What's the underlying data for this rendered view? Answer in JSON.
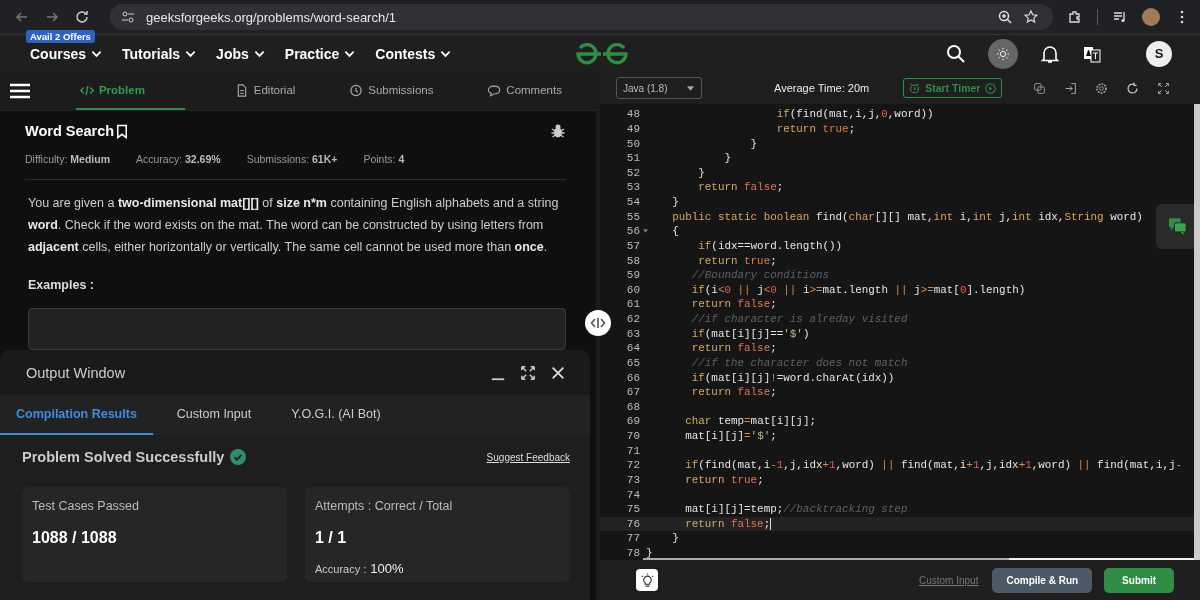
{
  "browser": {
    "url": "geeksforgeeks.org/problems/word-search/1"
  },
  "site_nav": {
    "offer_badge": "Avail 2 Offers",
    "items": [
      "Courses",
      "Tutorials",
      "Jobs",
      "Practice",
      "Contests"
    ],
    "avatar_letter": "S"
  },
  "problem_panel": {
    "tabs": [
      {
        "label": "Problem",
        "selected": true,
        "kind": "code"
      },
      {
        "label": "Editorial",
        "selected": false,
        "kind": "doc"
      },
      {
        "label": "Submissions",
        "selected": false,
        "kind": "clock"
      },
      {
        "label": "Comments",
        "selected": false,
        "kind": "chat"
      }
    ],
    "title": "Word Search",
    "meta": [
      "Difficulty: **Medium**",
      "Accuracy: **32.69%**",
      "Submissions: **61K+**",
      "Points: **4**"
    ],
    "description": "You are given a **two-dimensional mat[][]** of **size n*m** containing English alphabets and a string **word**. Check if the word exists on the mat. The word can be constructed by using letters from **adjacent** cells, either horizontally or vertically. The same cell cannot be used more than **once**.",
    "examples_heading": "Examples :"
  },
  "output_window": {
    "title": "Output Window",
    "tabs": [
      {
        "label": "Compilation Results",
        "selected": true
      },
      {
        "label": "Custom Input",
        "selected": false
      },
      {
        "label": "Y.O.G.I. (AI Bot)",
        "selected": false
      }
    ],
    "status": "Problem Solved Successfully",
    "feedback_link": "Suggest Feedback",
    "cards": [
      {
        "label": "Test Cases Passed",
        "value": "1088 / 1088"
      },
      {
        "label": "Attempts : Correct / Total",
        "value": "1 / 1",
        "sub_label": "Accuracy :",
        "sub_value": "100%"
      }
    ]
  },
  "editor": {
    "language": "Java (1.8)",
    "average_time": "Average Time: 20m",
    "timer_button": "Start Timer",
    "lines": [
      {
        "number": "48",
        "active": false,
        "foldable": false,
        "tokens": [
          {
            "kind": "keyword",
            "text": "                    if"
          },
          {
            "kind": "plain",
            "text": "(find(mat,i,j,"
          },
          {
            "kind": "number",
            "text": "0"
          },
          {
            "kind": "plain",
            "text": ",word))"
          }
        ]
      },
      {
        "number": "49",
        "active": false,
        "foldable": false,
        "tokens": [
          {
            "kind": "keyword",
            "text": "                    return "
          },
          {
            "kind": "literal",
            "text": "true"
          },
          {
            "kind": "plain",
            "text": ";"
          }
        ]
      },
      {
        "number": "50",
        "active": false,
        "foldable": false,
        "tokens": [
          {
            "kind": "plain",
            "text": "                }"
          }
        ]
      },
      {
        "number": "51",
        "active": false,
        "foldable": false,
        "tokens": [
          {
            "kind": "plain",
            "text": "            }"
          }
        ]
      },
      {
        "number": "52",
        "active": false,
        "foldable": false,
        "tokens": [
          {
            "kind": "plain",
            "text": "        }"
          }
        ]
      },
      {
        "number": "53",
        "active": false,
        "foldable": false,
        "tokens": [
          {
            "kind": "keyword",
            "text": "        return "
          },
          {
            "kind": "literal",
            "text": "false"
          },
          {
            "kind": "plain",
            "text": ";"
          }
        ]
      },
      {
        "number": "54",
        "active": false,
        "foldable": false,
        "tokens": [
          {
            "kind": "plain",
            "text": "    }"
          }
        ]
      },
      {
        "number": "55",
        "active": false,
        "foldable": false,
        "tokens": [
          {
            "kind": "keyword",
            "text": "    public static boolean "
          },
          {
            "kind": "plain",
            "text": "find("
          },
          {
            "kind": "keyword",
            "text": "char"
          },
          {
            "kind": "plain",
            "text": "[][] mat,"
          },
          {
            "kind": "keyword",
            "text": "int "
          },
          {
            "kind": "plain",
            "text": "i,"
          },
          {
            "kind": "keyword",
            "text": "int "
          },
          {
            "kind": "plain",
            "text": "j,"
          },
          {
            "kind": "keyword",
            "text": "int "
          },
          {
            "kind": "plain",
            "text": "idx,"
          },
          {
            "kind": "keyword",
            "text": "String "
          },
          {
            "kind": "plain",
            "text": "word)"
          }
        ]
      },
      {
        "number": "56",
        "active": false,
        "foldable": true,
        "tokens": [
          {
            "kind": "plain",
            "text": "    {"
          }
        ]
      },
      {
        "number": "57",
        "active": false,
        "foldable": false,
        "tokens": [
          {
            "kind": "keyword",
            "text": "        if"
          },
          {
            "kind": "plain",
            "text": "(idx==word.length())"
          }
        ]
      },
      {
        "number": "58",
        "active": false,
        "foldable": false,
        "tokens": [
          {
            "kind": "keyword",
            "text": "        return "
          },
          {
            "kind": "literal",
            "text": "true"
          },
          {
            "kind": "plain",
            "text": ";"
          }
        ]
      },
      {
        "number": "59",
        "active": false,
        "foldable": false,
        "tokens": [
          {
            "kind": "comment",
            "text": "       //Boundary conditions"
          }
        ]
      },
      {
        "number": "60",
        "active": false,
        "foldable": false,
        "tokens": [
          {
            "kind": "keyword",
            "text": "       if"
          },
          {
            "kind": "plain",
            "text": "(i"
          },
          {
            "kind": "operator",
            "text": "<"
          },
          {
            "kind": "number",
            "text": "0"
          },
          {
            "kind": "operator",
            "text": " || "
          },
          {
            "kind": "plain",
            "text": "j"
          },
          {
            "kind": "operator",
            "text": "<"
          },
          {
            "kind": "number",
            "text": "0"
          },
          {
            "kind": "operator",
            "text": " || "
          },
          {
            "kind": "plain",
            "text": "i"
          },
          {
            "kind": "operator",
            "text": ">="
          },
          {
            "kind": "plain",
            "text": "mat.length"
          },
          {
            "kind": "operator",
            "text": " || "
          },
          {
            "kind": "plain",
            "text": "j"
          },
          {
            "kind": "operator",
            "text": ">="
          },
          {
            "kind": "plain",
            "text": "mat["
          },
          {
            "kind": "number",
            "text": "0"
          },
          {
            "kind": "plain",
            "text": "].length)"
          }
        ]
      },
      {
        "number": "61",
        "active": false,
        "foldable": false,
        "tokens": [
          {
            "kind": "keyword",
            "text": "       return "
          },
          {
            "kind": "literal",
            "text": "false"
          },
          {
            "kind": "plain",
            "text": ";"
          }
        ]
      },
      {
        "number": "62",
        "active": false,
        "foldable": false,
        "tokens": [
          {
            "kind": "comment",
            "text": "       //if character is alreday visited"
          }
        ]
      },
      {
        "number": "63",
        "active": false,
        "foldable": false,
        "tokens": [
          {
            "kind": "keyword",
            "text": "       if"
          },
          {
            "kind": "plain",
            "text": "(mat[i][j]=="
          },
          {
            "kind": "string",
            "text": "'$'"
          },
          {
            "kind": "plain",
            "text": ")"
          }
        ]
      },
      {
        "number": "64",
        "active": false,
        "foldable": false,
        "tokens": [
          {
            "kind": "keyword",
            "text": "       return "
          },
          {
            "kind": "literal",
            "text": "false"
          },
          {
            "kind": "plain",
            "text": ";"
          }
        ]
      },
      {
        "number": "65",
        "active": false,
        "foldable": false,
        "tokens": [
          {
            "kind": "comment",
            "text": "       //if the character does not match"
          }
        ]
      },
      {
        "number": "66",
        "active": false,
        "foldable": false,
        "tokens": [
          {
            "kind": "keyword",
            "text": "       if"
          },
          {
            "kind": "plain",
            "text": "(mat[i][j]"
          },
          {
            "kind": "operator",
            "text": "!"
          },
          {
            "kind": "plain",
            "text": "=word.charAt(idx))"
          }
        ]
      },
      {
        "number": "67",
        "active": false,
        "foldable": false,
        "tokens": [
          {
            "kind": "keyword",
            "text": "       return "
          },
          {
            "kind": "literal",
            "text": "false"
          },
          {
            "kind": "plain",
            "text": ";"
          }
        ]
      },
      {
        "number": "68",
        "active": false,
        "foldable": false
      },
      {
        "number": "69",
        "active": false,
        "foldable": false,
        "tokens": [
          {
            "kind": "keyword",
            "text": "      char "
          },
          {
            "kind": "plain",
            "text": "temp"
          },
          {
            "kind": "operator",
            "text": "="
          },
          {
            "kind": "plain",
            "text": "mat[i][j];"
          }
        ]
      },
      {
        "number": "70",
        "active": false,
        "foldable": false,
        "tokens": [
          {
            "kind": "plain",
            "text": "      mat[i][j]"
          },
          {
            "kind": "operator",
            "text": "="
          },
          {
            "kind": "string",
            "text": "'$'"
          },
          {
            "kind": "plain",
            "text": ";"
          }
        ]
      },
      {
        "number": "71",
        "active": false,
        "foldable": false
      },
      {
        "number": "72",
        "active": false,
        "foldable": false,
        "tokens": [
          {
            "kind": "keyword",
            "text": "      if"
          },
          {
            "kind": "plain",
            "text": "(find(mat,i"
          },
          {
            "kind": "operator",
            "text": "-"
          },
          {
            "kind": "number",
            "text": "1"
          },
          {
            "kind": "plain",
            "text": ",j,idx"
          },
          {
            "kind": "operator",
            "text": "+"
          },
          {
            "kind": "number",
            "text": "1"
          },
          {
            "kind": "plain",
            "text": ",word)"
          },
          {
            "kind": "operator",
            "text": " || "
          },
          {
            "kind": "plain",
            "text": "find(mat,i"
          },
          {
            "kind": "operator",
            "text": "+"
          },
          {
            "kind": "number",
            "text": "1"
          },
          {
            "kind": "plain",
            "text": ",j,idx"
          },
          {
            "kind": "operator",
            "text": "+"
          },
          {
            "kind": "number",
            "text": "1"
          },
          {
            "kind": "plain",
            "text": ",word)"
          },
          {
            "kind": "operator",
            "text": " || "
          },
          {
            "kind": "plain",
            "text": "find(mat,i,j"
          },
          {
            "kind": "operator",
            "text": "-"
          }
        ]
      },
      {
        "number": "73",
        "active": false,
        "foldable": false,
        "tokens": [
          {
            "kind": "keyword",
            "text": "      return "
          },
          {
            "kind": "literal",
            "text": "true"
          },
          {
            "kind": "plain",
            "text": ";"
          }
        ]
      },
      {
        "number": "74",
        "active": false,
        "foldable": false
      },
      {
        "number": "75",
        "active": false,
        "foldable": false,
        "tokens": [
          {
            "kind": "plain",
            "text": "      mat[i][j]=temp;"
          },
          {
            "kind": "comment",
            "text": "//backtracking step"
          }
        ]
      },
      {
        "number": "76",
        "active": true,
        "foldable": false,
        "tokens": [
          {
            "kind": "keyword",
            "text": "      return "
          },
          {
            "kind": "literal",
            "text": "false"
          },
          {
            "kind": "plain",
            "text": ";"
          }
        ]
      },
      {
        "number": "77",
        "active": false,
        "foldable": false,
        "tokens": [
          {
            "kind": "plain",
            "text": "    }"
          }
        ]
      },
      {
        "number": "78",
        "active": false,
        "foldable": false,
        "tokens": [
          {
            "kind": "plain",
            "text": "}"
          }
        ]
      }
    ]
  },
  "editor_footer": {
    "custom_input": "Custom Input",
    "compile_button": "Compile & Run",
    "submit_button": "Submit"
  }
}
